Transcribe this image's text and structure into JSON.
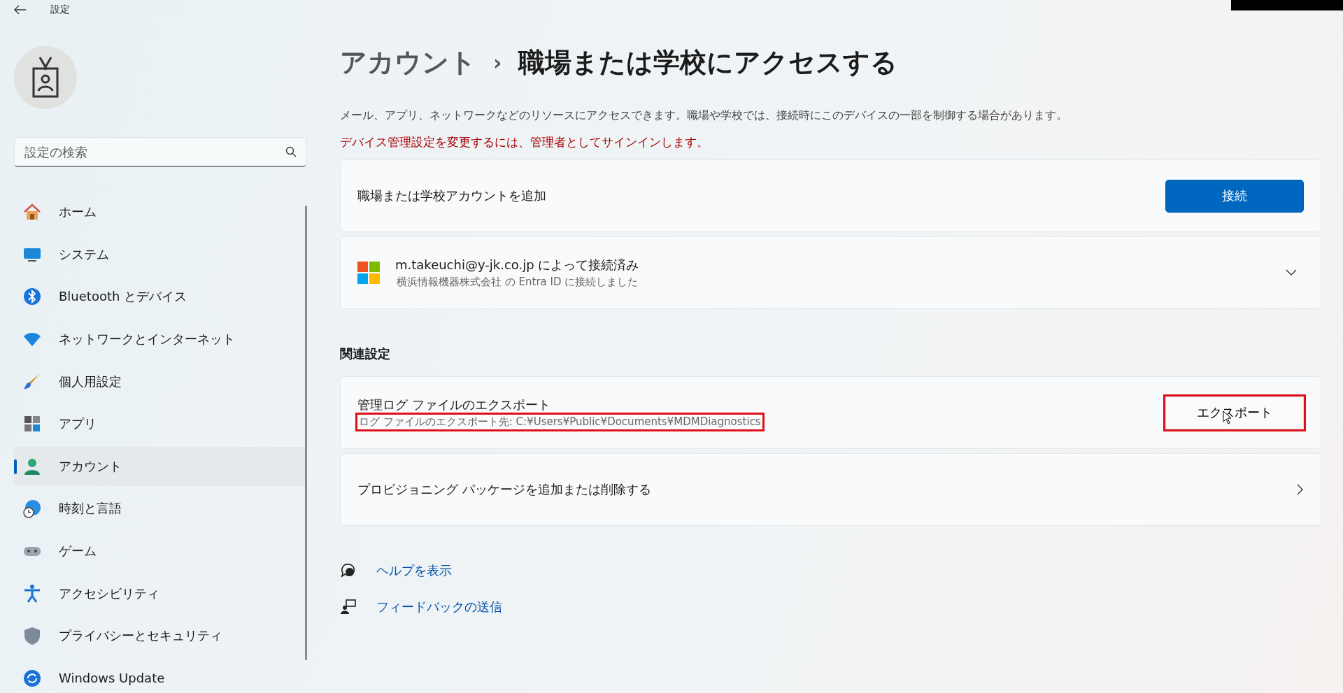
{
  "window": {
    "title": "設定"
  },
  "search": {
    "placeholder": "設定の検索"
  },
  "sidebar": {
    "items": [
      {
        "label": "ホーム",
        "selected": false
      },
      {
        "label": "システム",
        "selected": false
      },
      {
        "label": "Bluetooth とデバイス",
        "selected": false
      },
      {
        "label": "ネットワークとインターネット",
        "selected": false
      },
      {
        "label": "個人用設定",
        "selected": false
      },
      {
        "label": "アプリ",
        "selected": false
      },
      {
        "label": "アカウント",
        "selected": true
      },
      {
        "label": "時刻と言語",
        "selected": false
      },
      {
        "label": "ゲーム",
        "selected": false
      },
      {
        "label": "アクセシビリティ",
        "selected": false
      },
      {
        "label": "プライバシーとセキュリティ",
        "selected": false
      },
      {
        "label": "Windows Update",
        "selected": false
      }
    ]
  },
  "breadcrumb": {
    "parent": "アカウント",
    "separator": "›",
    "current": "職場または学校にアクセスする"
  },
  "description": "メール、アプリ、ネットワークなどのリソースにアクセスできます。職場や学校では、接続時にこのデバイスの一部を制御する場合があります。",
  "warning": "デバイス管理設定を変更するには、管理者としてサインインします。",
  "add_account": {
    "label": "職場または学校アカウントを追加",
    "button": "接続"
  },
  "connected_account": {
    "title": "m.takeuchi@y-jk.co.jp によって接続済み",
    "subtitle": "横浜情報機器株式会社 の Entra ID に接続しました",
    "expanded": false
  },
  "related_settings": {
    "heading": "関連設定",
    "items": [
      {
        "kind": "button",
        "title": "管理ログ ファイルのエクスポート",
        "subtitle": "ログ ファイルのエクスポート先: C:¥Users¥Public¥Documents¥MDMDiagnostics",
        "subtitle_highlighted": true,
        "button": "エクスポート",
        "button_highlighted": true
      },
      {
        "kind": "link",
        "title": "プロビジョニング パッケージを追加または削除する"
      }
    ]
  },
  "footer_links": [
    "ヘルプを表示",
    "フィードバックの送信"
  ]
}
